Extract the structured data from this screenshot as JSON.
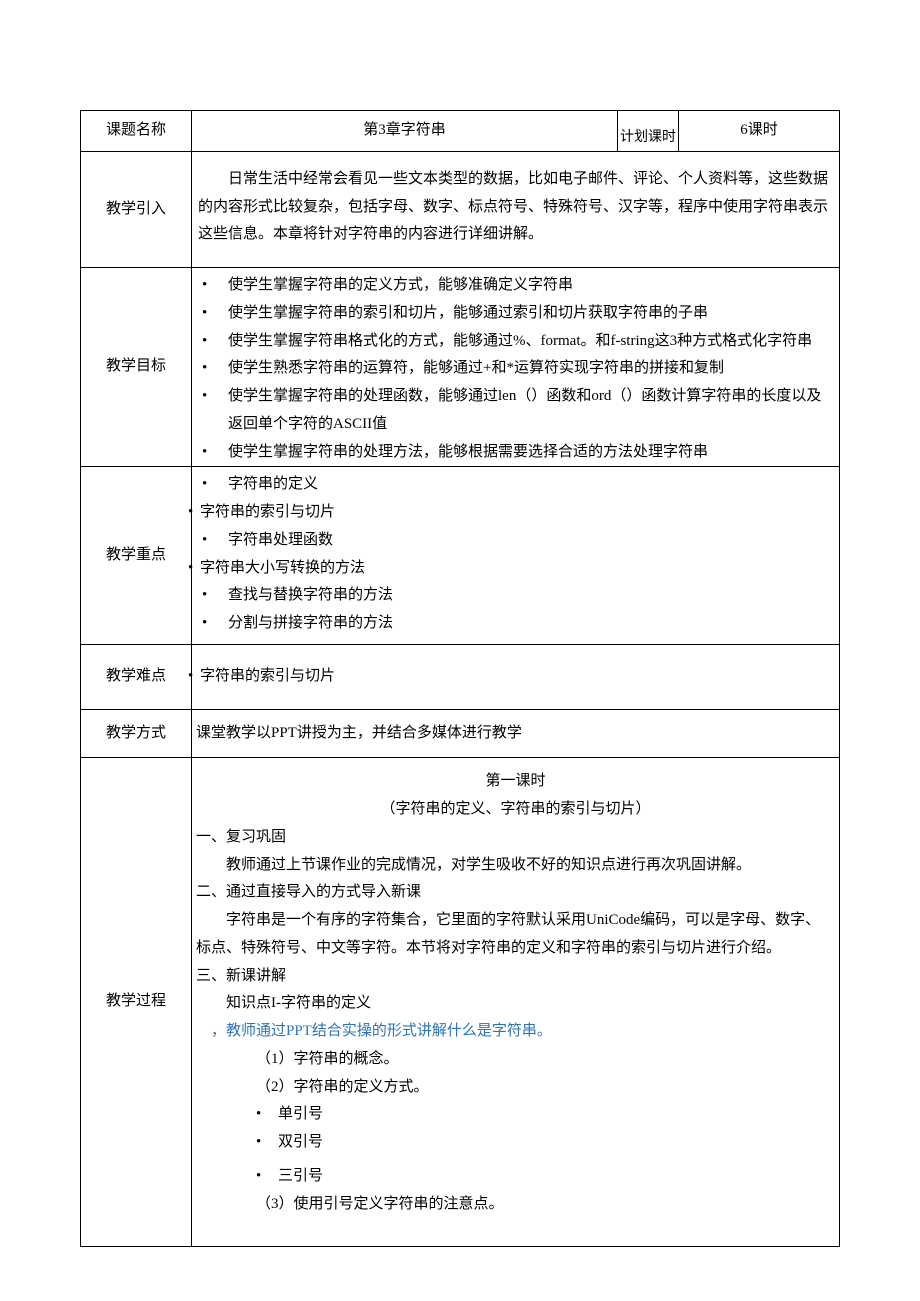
{
  "labels": {
    "topic_name": "课题名称",
    "plan_hours_label": "计划课时",
    "intro": "教学引入",
    "goals": "教学目标",
    "focus": "教学重点",
    "difficulty": "教学难点",
    "mode": "教学方式",
    "process": "教学过程"
  },
  "header": {
    "topic_value": "第3章字符串",
    "hours_value": "6课时"
  },
  "intro_text": "日常生活中经常会看见一些文本类型的数据，比如电子邮件、评论、个人资料等，这些数据的内容形式比较复杂，包括字母、数字、标点符号、特殊符号、汉字等，程序中使用字符串表示这些信息。本章将针对字符串的内容进行详细讲解。",
  "goals": [
    "使学生掌握字符串的定义方式，能够准确定义字符串",
    "使学生掌握字符串的索引和切片，能够通过索引和切片获取字符串的子串",
    "使学生掌握字符串格式化的方式，能够通过%、format。和f-string这3种方式格式化字符串",
    "使学生熟悉字符串的运算符，能够通过+和*运算符实现字符串的拼接和复制",
    "使学生掌握字符串的处理函数，能够通过len（）函数和ord（）函数计算字符串的长度以及返回单个字符的ASCII值",
    "使学生掌握字符串的处理方法，能够根据需要选择合适的方法处理字符串"
  ],
  "focus_items": {
    "f1": "字符串的定义",
    "f2": "字符串的索引与切片",
    "f3": "字符串处理函数",
    "f4": "字符串大小写转换的方法",
    "f5": "查找与替换字符串的方法",
    "f6": "分割与拼接字符串的方法"
  },
  "difficulty_text": "字符串的索引与切片",
  "mode_text": "课堂教学以PPT讲授为主，并结合多媒体进行教学",
  "process": {
    "title1": "第一课时",
    "title2": "（字符串的定义、字符串的索引与切片）",
    "s1": "一、复习巩固",
    "s1_body": "教师通过上节课作业的完成情况，对学生吸收不好的知识点进行再次巩固讲解。",
    "s2": "二、通过直接导入的方式导入新课",
    "s2_body": "字符串是一个有序的字符集合，它里面的字符默认采用UniCode编码，可以是字母、数字、标点、特殊符号、中文等字符。本节将对字符串的定义和字符串的索引与切片进行介绍。",
    "s3": "三、新课讲解",
    "kp1": "知识点I-字符串的定义",
    "kp1_note": "，教师通过PPT结合实操的形式讲解什么是字符串。",
    "kp1_1": "（1）字符串的概念。",
    "kp1_2": "（2）字符串的定义方式。",
    "opt1": "单引号",
    "opt2": "双引号",
    "opt3": "三引号",
    "kp1_3": "（3）使用引号定义字符串的注意点。"
  },
  "bullet_char": "•"
}
